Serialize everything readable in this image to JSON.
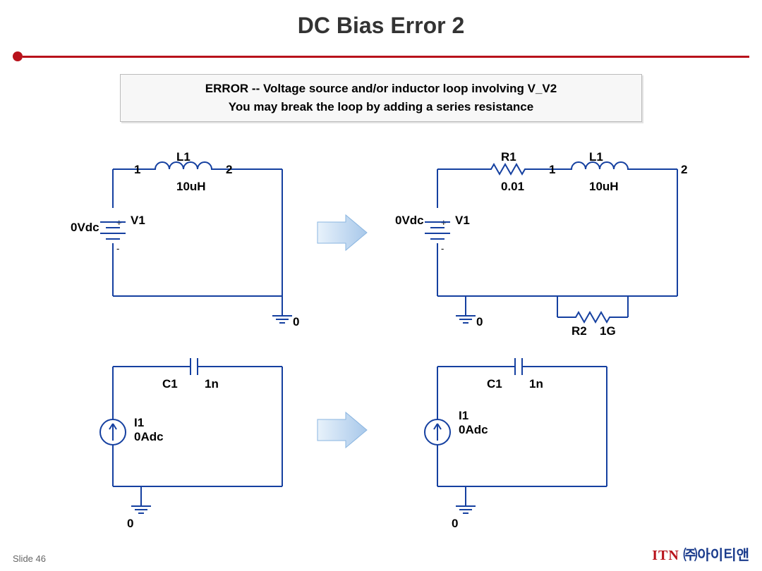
{
  "title": "DC Bias Error 2",
  "errorbox": {
    "line1": "ERROR -- Voltage source and/or inductor loop involving V_V2",
    "line2": "You may break the loop by adding a series resistance"
  },
  "circuit1": {
    "L1_name": "L1",
    "L1_val": "10uH",
    "node1": "1",
    "node2": "2",
    "V1_name": "V1",
    "V1_val": "0Vdc",
    "gnd": "0"
  },
  "circuit2": {
    "R1_name": "R1",
    "R1_val": "0.01",
    "L1_name": "L1",
    "L1_val": "10uH",
    "node1": "1",
    "node2": "2",
    "V1_name": "V1",
    "V1_val": "0Vdc",
    "R2_name": "R2",
    "R2_val": "1G",
    "gnd": "0"
  },
  "circuit3": {
    "C1_name": "C1",
    "C1_val": "1n",
    "I1_name": "I1",
    "I1_val": "0Adc",
    "gnd": "0"
  },
  "circuit4": {
    "C1_name": "C1",
    "C1_val": "1n",
    "I1_name": "I1",
    "I1_val": "0Adc",
    "gnd": "0"
  },
  "footer": {
    "slide": "Slide 46",
    "brand_itn": "ITN",
    "brand_kr": "㈜아이티앤"
  }
}
